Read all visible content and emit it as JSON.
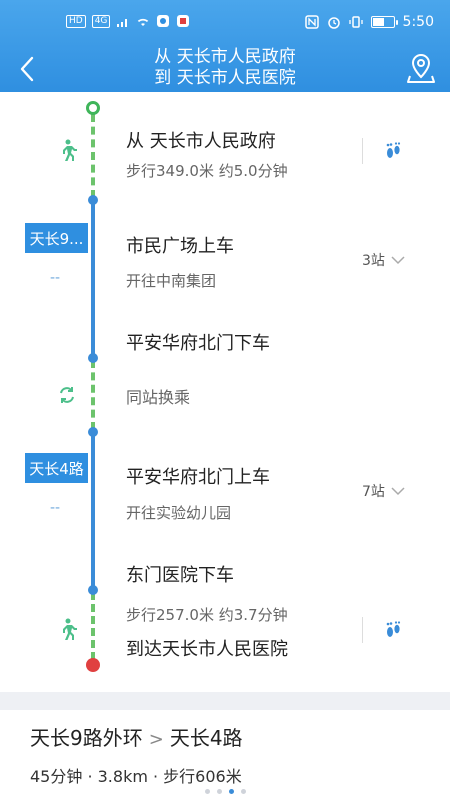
{
  "status_bar": {
    "left_badges": [
      "HD",
      "4G"
    ],
    "time": "5:50",
    "battery_level": 0.55
  },
  "header": {
    "title_line1": "从 天长市人民政府",
    "title_line2": "到 天长市人民医院"
  },
  "route": {
    "start": {
      "title": "从 天长市人民政府",
      "walk": "步行349.0米 约5.0分钟"
    },
    "segments": [
      {
        "bus_label": "天长9...",
        "board": "市民广场上车",
        "direction": "开往中南集团",
        "stops": "3站",
        "alight": "平安华府北门下车",
        "dashes": "--"
      },
      {
        "bus_label": "天长4路",
        "board": "平安华府北门上车",
        "direction": "开往实验幼儿园",
        "stops": "7站",
        "alight": "东门医院下车",
        "dashes": "--"
      }
    ],
    "transfer": "同站换乘",
    "end": {
      "walk": "步行257.0米 约3.7分钟",
      "title": "到达天长市人民医院"
    }
  },
  "summary": {
    "line1": "天长9路外环",
    "arrow": ">",
    "line2": "天长4路",
    "info": "45分钟 · 3.8km · 步行606米",
    "pages": 4,
    "active_page": 3
  },
  "colors": {
    "primary": "#2f8fe0",
    "walk_line": "#6cc36c",
    "bus_line": "#3a8cd8",
    "end_dot": "#e04040"
  },
  "icons": {
    "back": "chevron-left-icon",
    "map": "map-pin-icon",
    "walk": "walking-person-icon",
    "transfer": "transfer-icon",
    "footprint": "footprint-icon"
  }
}
